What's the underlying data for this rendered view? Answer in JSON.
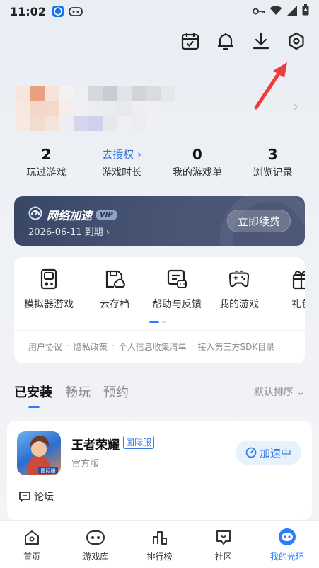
{
  "status_bar": {
    "time": "11:02"
  },
  "stats": [
    {
      "value": "2",
      "label": "玩过游戏"
    },
    {
      "value": "去授权 ›",
      "label": "游戏时长"
    },
    {
      "value": "0",
      "label": "我的游戏单"
    },
    {
      "value": "3",
      "label": "浏览记录"
    }
  ],
  "vip": {
    "title": "网络加速",
    "badge": "VIP",
    "expiry": "2026-06-11 到期 ›",
    "renew_label": "立即续费"
  },
  "tools": [
    {
      "label": "模拟器游戏",
      "icon": "gameboy-icon"
    },
    {
      "label": "云存档",
      "icon": "cloud-save-icon"
    },
    {
      "label": "帮助与反馈",
      "icon": "feedback-icon"
    },
    {
      "label": "我的游戏",
      "icon": "gamepad-icon"
    },
    {
      "label": "礼包",
      "icon": "gift-icon"
    }
  ],
  "links": [
    "用户协议",
    "隐私政策",
    "个人信息收集清单",
    "接入第三方SDK目录"
  ],
  "tabs": [
    {
      "label": "已安装",
      "active": true
    },
    {
      "label": "畅玩",
      "active": false
    },
    {
      "label": "预约",
      "active": false
    }
  ],
  "sort_label": "默认排序 ⌄",
  "game": {
    "name": "王者荣耀",
    "server_tag": "国际服",
    "subtitle": "官方版",
    "accel_label": "加速中",
    "forum_label": "论坛",
    "avatar_text": "国际服"
  },
  "bottom_nav": [
    {
      "label": "首页",
      "active": false
    },
    {
      "label": "游戏库",
      "active": false
    },
    {
      "label": "排行榜",
      "active": false
    },
    {
      "label": "社区",
      "active": false
    },
    {
      "label": "我的光环",
      "active": true
    }
  ],
  "colors": {
    "accent": "#2b7cff",
    "vip_bg": "#3f4c6b"
  }
}
